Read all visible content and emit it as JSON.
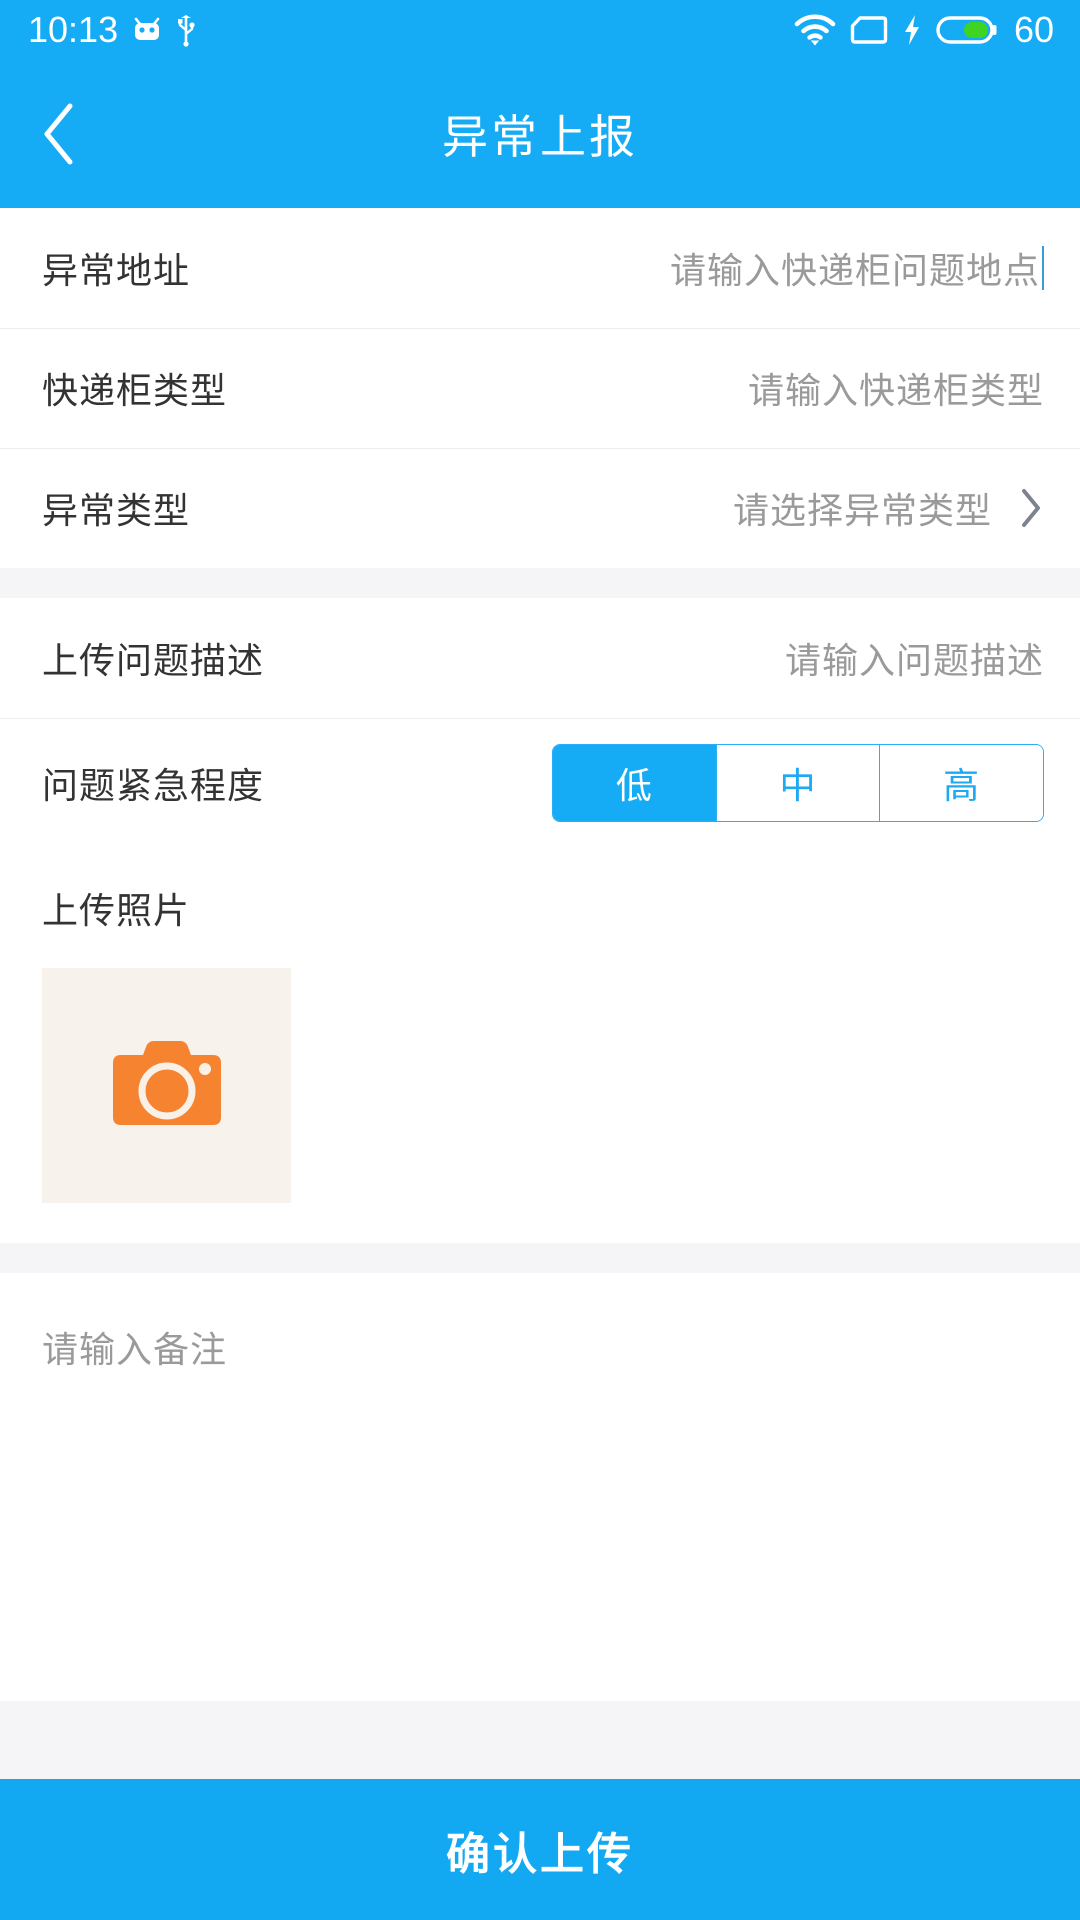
{
  "status_bar": {
    "time": "10:13",
    "battery_percent": "60",
    "icons": [
      "android-robot-icon",
      "usb-icon",
      "wifi-icon",
      "sim-card-icon",
      "charging-bolt-icon",
      "battery-icon"
    ],
    "background_color": "#15ABF5"
  },
  "title_bar": {
    "title": "异常上报",
    "back_icon": "chevron-left-icon",
    "background_color": "#15ABF5"
  },
  "form": {
    "section_one": [
      {
        "label": "异常地址",
        "placeholder": "请输入快递柜问题地点",
        "value": "",
        "type": "text-input",
        "focused": true
      },
      {
        "label": "快递柜类型",
        "placeholder": "请输入快递柜类型",
        "value": "",
        "type": "text-input",
        "focused": false
      },
      {
        "label": "异常类型",
        "placeholder": "请选择异常类型",
        "value": "",
        "type": "selector",
        "chevron": "chevron-right-icon",
        "focused": false
      }
    ],
    "section_two": {
      "description_row": {
        "label": "上传问题描述",
        "placeholder": "请输入问题描述",
        "value": ""
      },
      "urgency_row": {
        "label": "问题紧急程度",
        "options": [
          "低",
          "中",
          "高"
        ],
        "selected_index": 0,
        "selected_value": "低",
        "active_color": "#15ABF5",
        "inactive_text_color": "#1EA9F5"
      }
    },
    "photo_section": {
      "title": "上传照片",
      "add_icon": "camera-icon",
      "icon_color": "#F5832F",
      "tile_background": "#F8F2EC"
    },
    "remarks": {
      "placeholder": "请输入备注",
      "value": ""
    }
  },
  "submit": {
    "label": "确认上传",
    "background_color": "#12A8F2"
  }
}
